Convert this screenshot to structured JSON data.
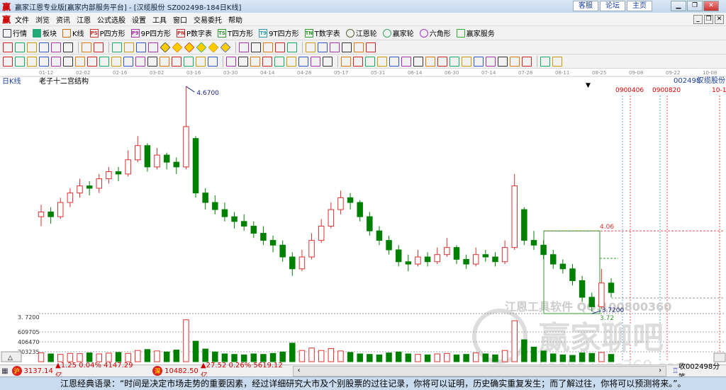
{
  "window": {
    "title": "赢家江恩专业版[赢家内部服务平台] - [汉缆股份  SZ002498-184日K线]",
    "links": [
      "客服",
      "论坛",
      "主页"
    ]
  },
  "menu": [
    "文件",
    "浏览",
    "资讯",
    "江恩",
    "公式选股",
    "设置",
    "工具",
    "窗口",
    "交易委托",
    "帮助"
  ],
  "toolbar1": [
    {
      "label": "行情",
      "icon": "quote-table-icon",
      "color": "#334"
    },
    {
      "label": "板块",
      "icon": "sector-icon",
      "color": "#2a7"
    },
    {
      "label": "K线",
      "icon": "candle-icon",
      "color": "#c60"
    },
    {
      "label": "P四方形",
      "icon": "p-square-icon",
      "color": "#c33",
      "tag": "PS"
    },
    {
      "label": "9P四方形",
      "icon": "9p-square-icon",
      "color": "#a3a",
      "tag": "P9"
    },
    {
      "label": "P数字表",
      "icon": "p-number-table-icon",
      "color": "#c33",
      "tag": "PN"
    },
    {
      "label": "T四方形",
      "icon": "t-square-icon",
      "color": "#393",
      "tag": "TS"
    },
    {
      "label": "9T四方形",
      "icon": "9t-square-icon",
      "color": "#39a",
      "tag": "T9"
    },
    {
      "label": "T数字表",
      "icon": "t-number-table-icon",
      "color": "#393",
      "tag": "TN"
    },
    {
      "label": "江恩轮",
      "icon": "gann-wheel-icon",
      "color": "#563"
    },
    {
      "label": "赢家轮",
      "icon": "winner-wheel-icon",
      "color": "#3a6"
    },
    {
      "label": "六角形",
      "icon": "hexagon-icon",
      "color": "#a3c"
    },
    {
      "label": "赢家服务",
      "icon": "dollar-icon",
      "color": "#3a3"
    }
  ],
  "toolbar2": [
    "period-icon",
    "grid-icon",
    "doc-icon",
    "indicator-icon",
    "indicator2-icon",
    "cursor-icon",
    "color-icon",
    "flag-icon",
    "first-icon",
    "last-icon",
    "left-icon",
    "right-icon",
    "diamond1-icon",
    "diamond2-icon",
    "diamond3-icon",
    "diamond4-icon",
    "diamond5-icon",
    "diamond6-icon",
    "hand-icon",
    "crosshair-icon",
    "draw-icon",
    "tag-icon",
    "chart-icon",
    "calendar-icon",
    "calculator-icon",
    "report-icon",
    "save-icon",
    "network-icon",
    "phone-icon"
  ],
  "toolbar3": [
    "pen-icon",
    "lines-icon",
    "fib-icon",
    "fib2-icon",
    "fib3-icon",
    "spiral-icon",
    "brush-icon",
    "circle-icon",
    "parallel-icon",
    "n2-icon",
    "angle-icon",
    "target-icon",
    "star-icon",
    "box-icon",
    "fan-icon",
    "gann-icon",
    "grid2-icon",
    "table-icon",
    "period-line-icon",
    "rect-icon",
    "fan2-icon",
    "box2-icon",
    "box3-icon",
    "ray-icon",
    "v-icon",
    "grid3-icon",
    "grid4-icon",
    "slash-icon",
    "ruler-icon",
    "percent-icon",
    "percent2-icon",
    "coin-icon",
    "level-icon",
    "level2-icon",
    "tool-icon",
    "arc-icon",
    "gold-icon",
    "angle2-icon",
    "f-icon",
    "fan3-icon",
    "fan4-icon",
    "mesh-icon",
    "mesh2-icon",
    "color-wheel-icon",
    "infinity-icon"
  ],
  "chart": {
    "period_label": "日K线",
    "indicator_name": "老子十二宫结构",
    "stock_code": "002498",
    "stock_name": "汉缆股份",
    "date_ticks": [
      "01-12",
      "02-02",
      "02-16",
      "03-02",
      "03-16",
      "03-30",
      "04-14",
      "04-28",
      "05-17",
      "05-31",
      "06-14",
      "06-30",
      "07-14",
      "07-28",
      "08-11",
      "08-25",
      "09-08",
      "09-22",
      "10-08"
    ],
    "forecast_labels": [
      "0900406",
      "0900820",
      "10-1"
    ],
    "high_label": "4.6700",
    "low_label": "3.7200",
    "box_top_label": "4.06",
    "box_bottom_label": "3.72",
    "price_axis_label": "3. 7200",
    "volume_ticks": [
      "609705",
      "406470",
      "203235"
    ],
    "watermark1": "江恩工具软件  QQ:100800360",
    "watermark2": "赢家聊吧",
    "watermark3": "liaoba.yjgs360.com",
    "colors": {
      "up": "#e03030",
      "down": "#008000",
      "box": "#339933",
      "label": "#1a237e"
    }
  },
  "chart_data": {
    "type": "candlestick",
    "ohlc": [
      [
        4.12,
        4.17,
        4.08,
        4.14
      ],
      [
        4.14,
        4.16,
        4.09,
        4.12
      ],
      [
        4.12,
        4.2,
        4.11,
        4.18
      ],
      [
        4.18,
        4.24,
        4.16,
        4.22
      ],
      [
        4.22,
        4.28,
        4.2,
        4.25
      ],
      [
        4.25,
        4.27,
        4.21,
        4.24
      ],
      [
        4.24,
        4.3,
        4.22,
        4.28
      ],
      [
        4.28,
        4.33,
        4.26,
        4.31
      ],
      [
        4.31,
        4.33,
        4.27,
        4.3
      ],
      [
        4.3,
        4.4,
        4.29,
        4.36
      ],
      [
        4.36,
        4.46,
        4.35,
        4.42
      ],
      [
        4.42,
        4.43,
        4.31,
        4.33
      ],
      [
        4.33,
        4.41,
        4.32,
        4.38
      ],
      [
        4.38,
        4.39,
        4.32,
        4.35
      ],
      [
        4.35,
        4.37,
        4.3,
        4.33
      ],
      [
        4.33,
        4.67,
        4.32,
        4.5
      ],
      [
        4.45,
        4.46,
        4.2,
        4.22
      ],
      [
        4.22,
        4.24,
        4.15,
        4.18
      ],
      [
        4.18,
        4.21,
        4.13,
        4.15
      ],
      [
        4.15,
        4.18,
        4.1,
        4.12
      ],
      [
        4.12,
        4.14,
        4.07,
        4.1
      ],
      [
        4.1,
        4.13,
        4.06,
        4.08
      ],
      [
        4.08,
        4.1,
        4.03,
        4.05
      ],
      [
        4.05,
        4.08,
        4.0,
        4.02
      ],
      [
        4.02,
        4.04,
        3.97,
        4.0
      ],
      [
        4.0,
        4.02,
        3.93,
        3.95
      ],
      [
        3.95,
        3.97,
        3.87,
        3.9
      ],
      [
        3.9,
        3.98,
        3.89,
        3.95
      ],
      [
        3.95,
        4.05,
        3.94,
        4.02
      ],
      [
        4.02,
        4.11,
        4.01,
        4.08
      ],
      [
        4.08,
        4.18,
        4.07,
        4.15
      ],
      [
        4.15,
        4.23,
        4.13,
        4.2
      ],
      [
        4.2,
        4.22,
        4.15,
        4.18
      ],
      [
        4.18,
        4.19,
        4.1,
        4.12
      ],
      [
        4.12,
        4.14,
        4.04,
        4.06
      ],
      [
        4.06,
        4.08,
        4.0,
        4.02
      ],
      [
        4.02,
        4.04,
        3.96,
        3.98
      ],
      [
        3.98,
        4.0,
        3.91,
        3.93
      ],
      [
        3.93,
        3.96,
        3.89,
        3.92
      ],
      [
        3.92,
        3.98,
        3.91,
        3.95
      ],
      [
        3.95,
        3.97,
        3.91,
        3.93
      ],
      [
        3.93,
        3.99,
        3.92,
        3.96
      ],
      [
        3.96,
        4.03,
        3.95,
        3.99
      ],
      [
        3.99,
        4.0,
        3.92,
        3.94
      ],
      [
        3.94,
        3.96,
        3.9,
        3.92
      ],
      [
        3.92,
        3.99,
        3.91,
        3.96
      ],
      [
        3.96,
        3.98,
        3.93,
        3.95
      ],
      [
        3.95,
        3.97,
        3.91,
        3.93
      ],
      [
        3.93,
        4.02,
        3.92,
        3.99
      ],
      [
        3.99,
        4.3,
        3.98,
        4.25
      ],
      [
        4.15,
        4.16,
        4.0,
        4.02
      ],
      [
        4.02,
        4.06,
        3.98,
        4.0
      ],
      [
        4.0,
        4.02,
        3.94,
        3.96
      ],
      [
        3.96,
        3.98,
        3.9,
        3.92
      ],
      [
        3.92,
        3.94,
        3.88,
        3.9
      ],
      [
        3.9,
        3.92,
        3.83,
        3.85
      ],
      [
        3.85,
        3.87,
        3.76,
        3.78
      ],
      [
        3.78,
        3.8,
        3.72,
        3.74
      ],
      [
        3.74,
        3.9,
        3.73,
        3.84
      ],
      [
        3.84,
        3.86,
        3.78,
        3.8
      ]
    ],
    "volume": [
      180000,
      160000,
      150000,
      170000,
      165000,
      180000,
      160000,
      175000,
      190000,
      170000,
      230000,
      250000,
      220000,
      200000,
      240000,
      860000,
      420000,
      260000,
      200000,
      160000,
      150000,
      140000,
      160000,
      150000,
      170000,
      200000,
      380000,
      230000,
      280000,
      230000,
      270000,
      220000,
      190000,
      160000,
      150000,
      140000,
      180000,
      200000,
      160000,
      150000,
      140000,
      160000,
      170000,
      140000,
      150000,
      180000,
      160000,
      140000,
      230000,
      840000,
      450000,
      300000,
      220000,
      160000,
      140000,
      130000,
      180000,
      170000,
      190000,
      150000
    ]
  },
  "status": {
    "sh_index": "3137.14",
    "sh_change": "▲1.25 0.04% 4147.29亿",
    "sz_index": "10482.50",
    "sz_change": "▲27.52 0.26% 5619.12亿",
    "right_text": "收002498分笔"
  },
  "quote": "江恩经典语录：“时间是决定市场走势的重要因素，经过详细研究大市及个别股票的过往记录，你将可以证明，历史确实重复发生；而了解过往，你将可以预测将来。”。"
}
